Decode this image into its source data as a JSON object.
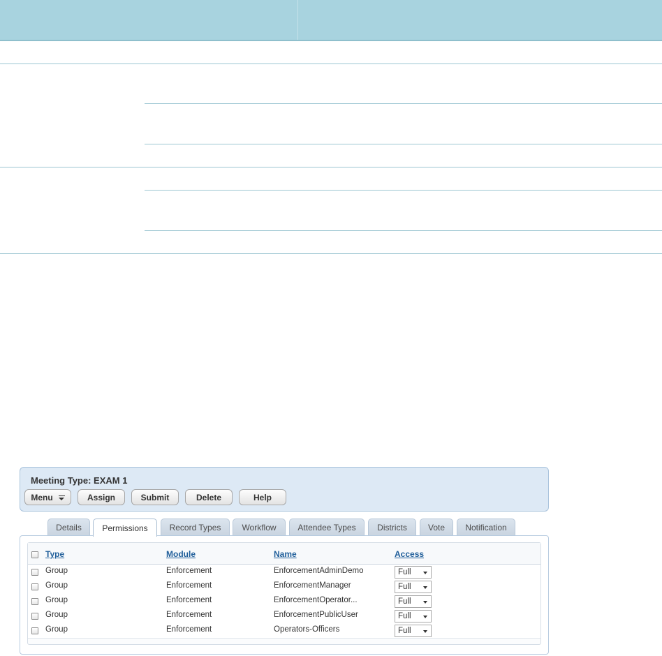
{
  "panel": {
    "title": "Meeting Type: EXAM 1",
    "buttons": {
      "menu": "Menu",
      "assign": "Assign",
      "submit": "Submit",
      "delete": "Delete",
      "help": "Help"
    }
  },
  "tabs": [
    {
      "label": "Details"
    },
    {
      "label": "Permissions",
      "active": true
    },
    {
      "label": "Record Types"
    },
    {
      "label": "Workflow"
    },
    {
      "label": "Attendee Types"
    },
    {
      "label": "Districts"
    },
    {
      "label": "Vote"
    },
    {
      "label": "Notification"
    }
  ],
  "grid": {
    "headers": {
      "type": "Type",
      "module": "Module",
      "name": "Name",
      "access": "Access"
    },
    "rows": [
      {
        "type": "Group",
        "module": "Enforcement",
        "name": "EnforcementAdminDemo",
        "access": "Full"
      },
      {
        "type": "Group",
        "module": "Enforcement",
        "name": "EnforcementManager",
        "access": "Full"
      },
      {
        "type": "Group",
        "module": "Enforcement",
        "name": "EnforcementOperator...",
        "access": "Full"
      },
      {
        "type": "Group",
        "module": "Enforcement",
        "name": "EnforcementPublicUser",
        "access": "Full"
      },
      {
        "type": "Group",
        "module": "Enforcement",
        "name": "Operators-Officers",
        "access": "Full"
      }
    ]
  },
  "icons": {
    "menu_button_icon": "menu-lines-icon",
    "select_arrow": "chevron-down-icon",
    "checkbox": "checkbox-icon"
  },
  "colors": {
    "doc_header": "#a8d3df",
    "doc_rule": "#9cc6d2",
    "panel_bg": "#dde9f5",
    "link": "#1f5e9a"
  }
}
